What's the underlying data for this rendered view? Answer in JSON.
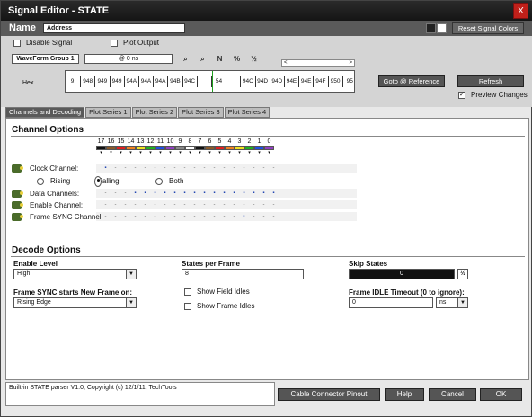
{
  "window": {
    "title": "Signal Editor - STATE",
    "close": "X"
  },
  "name": {
    "label": "Name",
    "value": "Address",
    "reset_colors": "Reset Signal Colors"
  },
  "top": {
    "disable_signal": "Disable Signal",
    "disable_checked": false,
    "plot_output": "Plot Output",
    "plot_checked": false,
    "waveform_group": "WaveForm Group 1",
    "at_time": "@ 0 ns",
    "hex_label": "Hex",
    "hex_values": [
      "9.",
      "948",
      "949",
      "949",
      "94A",
      "94A",
      "94A",
      "94B",
      "94C",
      "",
      "54",
      "",
      "94C",
      "94D",
      "94D",
      "94E",
      "94E",
      "94F",
      "950",
      "95"
    ],
    "scroll_left": "<",
    "scroll_right": ">",
    "goto_ref": "Goto @ Reference",
    "refresh": "Refresh",
    "preview": "Preview Changes",
    "preview_checked": true,
    "toolbar_icons": [
      "zoom-in-icon",
      "zoom-out-icon",
      "n-divider-icon",
      "percent-icon",
      "fraction-icon"
    ],
    "toolbar_glyphs": [
      "⌕",
      "⌕",
      "N",
      "%",
      "½"
    ]
  },
  "tabs": [
    "Channels and Decoding",
    "Plot Series 1",
    "Plot Series 2",
    "Plot Series 3",
    "Plot Series 4"
  ],
  "channel_options": {
    "title": "Channel Options",
    "channels": [
      "17",
      "16",
      "15",
      "14",
      "13",
      "12",
      "11",
      "10",
      "9",
      "8",
      "7",
      "6",
      "5",
      "4",
      "3",
      "2",
      "1",
      "0"
    ],
    "channel_colors": [
      "#111111",
      "#8a5a2a",
      "#e02020",
      "#f08020",
      "#f0e020",
      "#20b020",
      "#2050e0",
      "#9040c0",
      "#888888",
      "#ffffff",
      "#111111",
      "#8a5a2a",
      "#e02020",
      "#f08020",
      "#f0e020",
      "#20b020",
      "#2050e0",
      "#9040c0"
    ],
    "clock_label": "Clock Channel:",
    "rising": "Rising",
    "falling": "Falling",
    "both": "Both",
    "edge_selected": "Falling",
    "data_label": "Data Channels:",
    "enable_label": "Enable Channel:",
    "sync_label": "Frame SYNC Channel",
    "clock_row": [
      1,
      0,
      0,
      0,
      0,
      0,
      0,
      0,
      0,
      0,
      0,
      0,
      0,
      0,
      0,
      0,
      0,
      0
    ],
    "data_row": [
      0,
      0,
      0,
      1,
      1,
      1,
      1,
      1,
      1,
      1,
      1,
      1,
      1,
      1,
      1,
      1,
      1,
      1
    ],
    "enable_row": [
      0,
      0,
      0,
      0,
      0,
      0,
      0,
      0,
      0,
      0,
      0,
      0,
      0,
      0,
      0,
      0,
      0,
      0
    ],
    "sync_row": [
      0,
      0,
      0,
      0,
      0,
      0,
      0,
      0,
      0,
      0,
      0,
      0,
      0,
      0,
      2,
      0,
      0,
      0
    ]
  },
  "decode_options": {
    "title": "Decode Options",
    "enable_level_label": "Enable Level",
    "enable_level": "High",
    "states_label": "States per Frame",
    "states_value": "8",
    "skip_label": "Skip States",
    "skip_value": "0",
    "sync_label": "Frame SYNC starts New Frame on:",
    "sync_value": "Rising Edge",
    "field_idles": "Show Field Idles",
    "frame_idles": "Show Frame Idles",
    "timeout_label": "Frame IDLE Timeout (0 to ignore):",
    "timeout_value": "0",
    "timeout_unit": "ns"
  },
  "footer": {
    "status": "Built-in STATE parser V1.0, Copyright (c) 12/1/11, TechTools",
    "cable": "Cable Connector Pinout",
    "help": "Help",
    "cancel": "Cancel",
    "ok": "OK"
  }
}
